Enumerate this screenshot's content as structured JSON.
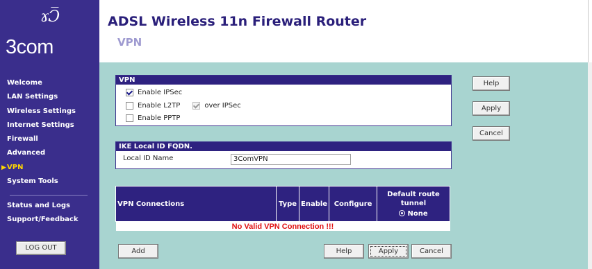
{
  "brand": {
    "logo_text": "3com",
    "logo_glyph": "ɤƆ̅"
  },
  "header": {
    "title": "ADSL Wireless 11n Firewall Router",
    "subtitle": "VPN"
  },
  "sidebar": {
    "items": [
      {
        "label": "Welcome"
      },
      {
        "label": "LAN Settings"
      },
      {
        "label": "Wireless Settings"
      },
      {
        "label": "Internet Settings"
      },
      {
        "label": "Firewall"
      },
      {
        "label": "Advanced"
      },
      {
        "label": "VPN",
        "active": true
      },
      {
        "label": "System Tools"
      }
    ],
    "secondary": [
      {
        "label": "Status and Logs"
      },
      {
        "label": "Support/Feedback"
      }
    ],
    "logout_label": "LOG OUT"
  },
  "vpn_panel": {
    "heading": "VPN",
    "enable_ipsec": {
      "label": "Enable IPSec",
      "checked": true
    },
    "enable_l2tp": {
      "label": "Enable L2TP",
      "checked": false
    },
    "over_ipsec": {
      "label": "over IPSec",
      "checked": true,
      "disabled": true
    },
    "enable_pptp": {
      "label": "Enable PPTP",
      "checked": false
    }
  },
  "ike_panel": {
    "heading": "IKE Local ID FQDN.",
    "local_id_label": "Local ID Name",
    "local_id_value": "3ComVPN"
  },
  "connections": {
    "columns": [
      "VPN Connections",
      "Type",
      "Enable",
      "Configure",
      "Default route tunnel"
    ],
    "none_option": "None",
    "empty_message": "No Valid VPN Connection !!!"
  },
  "buttons": {
    "side_help": "Help",
    "side_apply": "Apply",
    "side_cancel": "Cancel",
    "add": "Add",
    "bottom_help": "Help",
    "bottom_apply": "Apply",
    "bottom_cancel": "Cancel"
  },
  "colors": {
    "sidebar_bg": "#3a2e8c",
    "content_bg": "#a8d4d0",
    "header_title": "#2a1f7a",
    "panel_head": "#2e2280",
    "error_text": "#e01010"
  },
  "icons": [
    "3com-logo",
    "nav-arrow-icon",
    "checkbox",
    "radio-selected-icon"
  ]
}
